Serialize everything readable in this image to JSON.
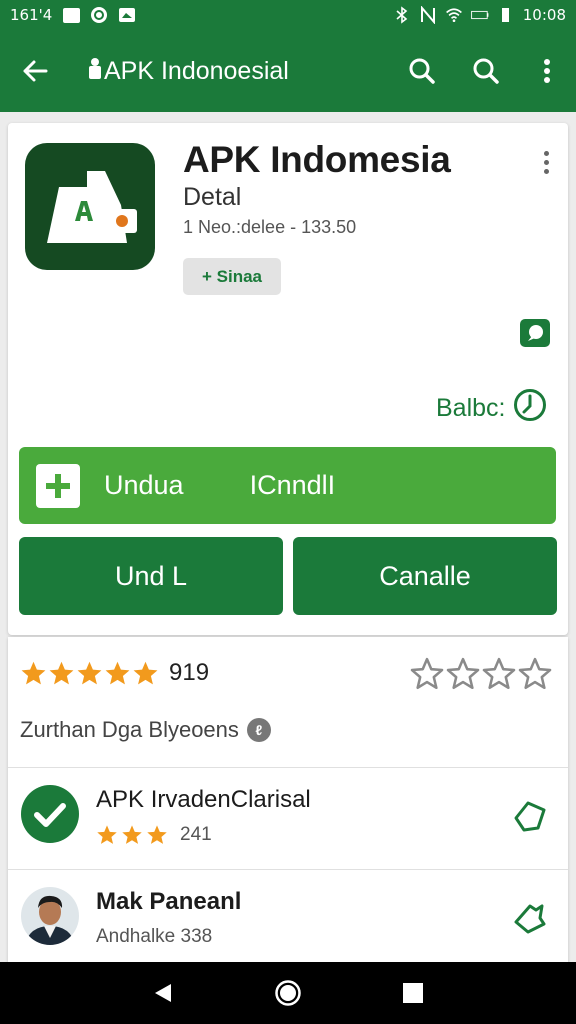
{
  "status_bar": {
    "left_text": "161'4",
    "time": "10:08"
  },
  "app_bar": {
    "title": "APK Indonoesial",
    "back_icon": "arrow-back-icon",
    "actions": [
      "search-icon",
      "search-icon",
      "more-vert-icon"
    ]
  },
  "header": {
    "app_name": "APK Indomesia",
    "subtitle": "Detal",
    "meta": "1 Neo.:delee - 133.50",
    "badge": "+ Sinaa",
    "balance_label": "Balbc:",
    "primary_button": {
      "label_1": "Undua",
      "label_2": "ICnndlI"
    },
    "button_left": "Und L",
    "button_right": "Canalle"
  },
  "rating": {
    "value": "919",
    "filled_stars": 5,
    "empty_stars": 4,
    "subline": "Zurthan Dga Blyeoens"
  },
  "list": [
    {
      "name": "APK IrvadenClarisal",
      "sub": "241",
      "stars": 3
    },
    {
      "name": "Mak Paneanl",
      "sub": "Andhalke 338"
    }
  ],
  "colors": {
    "primary": "#1b7a3a",
    "accent": "#4aaa3c",
    "star": "#f29a1d"
  }
}
